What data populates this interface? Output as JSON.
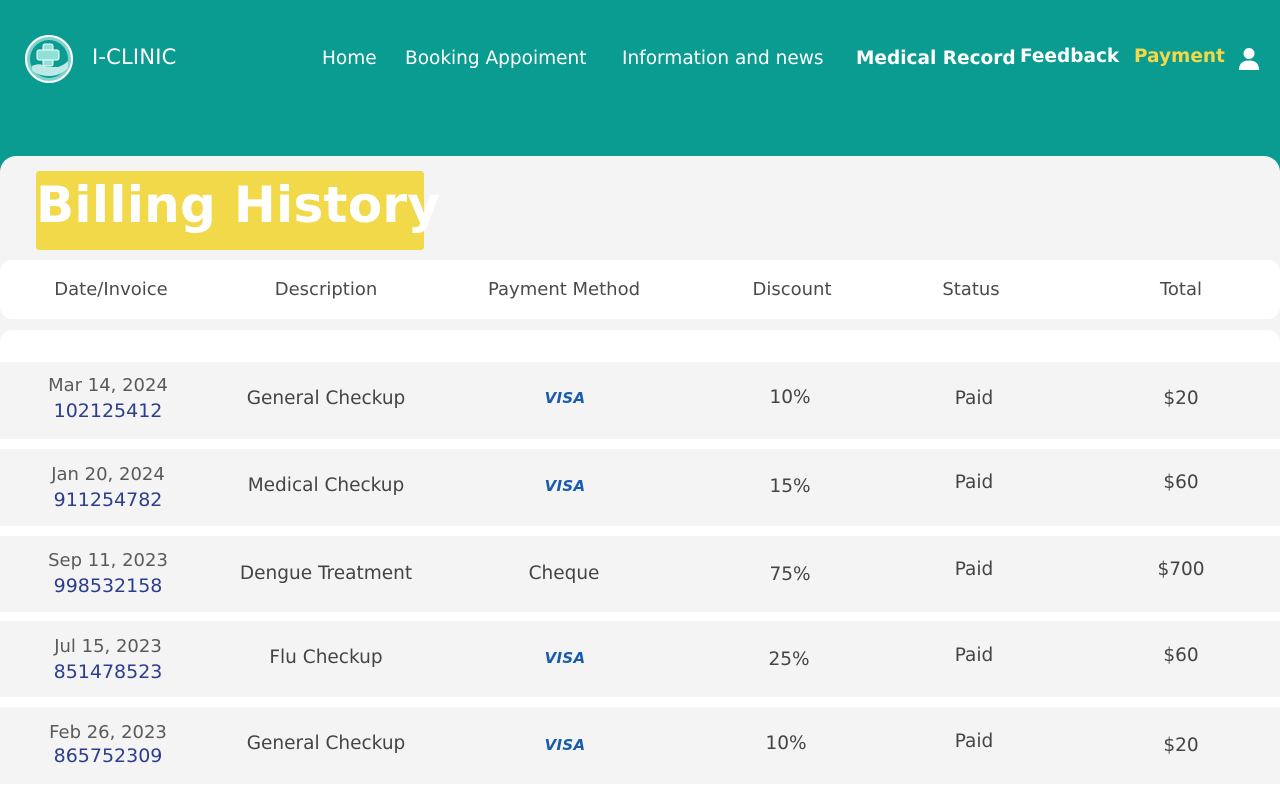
{
  "brand": {
    "name": "I-CLINIC",
    "colors": {
      "primary": "#0a9b91",
      "accent": "#f2d94a",
      "invoice": "#2d3d8e",
      "visa": "#1a5cac"
    },
    "logo_icon": "medical-cross-hand-icon"
  },
  "nav": {
    "home": "Home",
    "booking": "Booking Appoiment",
    "info": "Information and news",
    "record": "Medical Record",
    "feedback": "Feedback",
    "payment": "Payment",
    "user_icon": "user-icon"
  },
  "page": {
    "title": "Billing History"
  },
  "table": {
    "headers": {
      "date": "Date/Invoice",
      "desc": "Description",
      "method": "Payment Method",
      "discount": "Discount",
      "status": "Status",
      "total": "Total"
    },
    "rows": [
      {
        "date": "Mar 14, 2024",
        "invoice": "102125412",
        "description": "General Checkup",
        "method": "VISA",
        "discount": "10%",
        "status": "Paid",
        "total": "$20"
      },
      {
        "date": "Jan 20, 2024",
        "invoice": "911254782",
        "description": "Medical Checkup",
        "method": "VISA",
        "discount": "15%",
        "status": "Paid",
        "total": "$60"
      },
      {
        "date": "Sep 11, 2023",
        "invoice": "998532158",
        "description": "Dengue Treatment",
        "method": "Cheque",
        "discount": "75%",
        "status": "Paid",
        "total": "$700"
      },
      {
        "date": "Jul 15, 2023",
        "invoice": "851478523",
        "description": "Flu Checkup",
        "method": "VISA",
        "discount": "25%",
        "status": "Paid",
        "total": "$60"
      },
      {
        "date": "Feb 26, 2023",
        "invoice": "865752309",
        "description": "General Checkup",
        "method": "VISA",
        "discount": "10%",
        "status": "Paid",
        "total": "$20"
      }
    ]
  }
}
